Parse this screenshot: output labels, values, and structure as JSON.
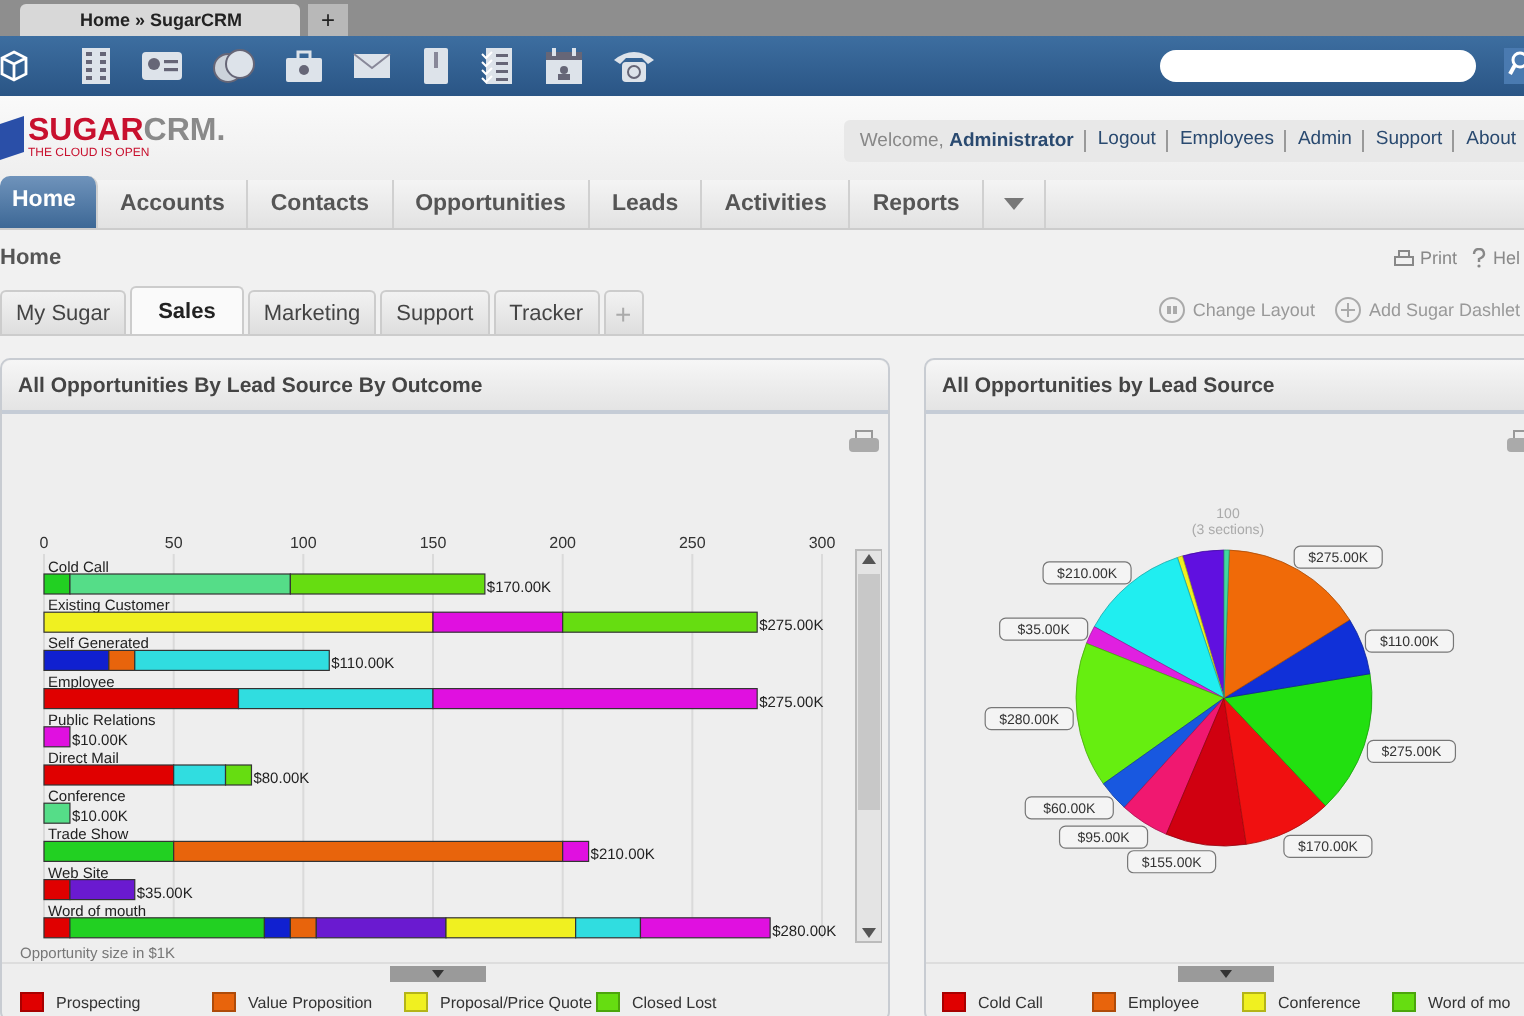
{
  "browser_tab": {
    "title": "Home » SugarCRM",
    "new_tab": "+"
  },
  "logo": {
    "primary": "SUGAR",
    "secondary": "CRM.",
    "tagline": "THE CLOUD IS OPEN"
  },
  "user_links": {
    "welcome": "Welcome, **Administrator**",
    "links": [
      "Logout",
      "Employees",
      "Admin",
      "Support",
      "About"
    ]
  },
  "main_tabs": [
    {
      "label": "Home",
      "selected": true
    },
    {
      "label": "Accounts",
      "selected": false
    },
    {
      "label": "Contacts",
      "selected": false
    },
    {
      "label": "Opportunities",
      "selected": false
    },
    {
      "label": "Leads",
      "selected": false
    },
    {
      "label": "Activities",
      "selected": false
    },
    {
      "label": "Reports",
      "selected": false
    }
  ],
  "page_title": "Home",
  "page_actions": [
    {
      "kind": "print",
      "label": "Print"
    },
    {
      "kind": "help",
      "label": "Hel"
    }
  ],
  "dashboard_tabs": [
    {
      "label": "My Sugar",
      "selected": false
    },
    {
      "label": "Sales",
      "selected": true
    },
    {
      "label": "Marketing",
      "selected": false
    },
    {
      "label": "Support",
      "selected": false
    },
    {
      "label": "Tracker",
      "selected": false
    }
  ],
  "add_tab": "+",
  "dashboard_actions": [
    {
      "kind": "layout",
      "label": "Change Layout"
    },
    {
      "kind": "add",
      "label": "Add Sugar Dashlet"
    }
  ],
  "dashlets": [
    {
      "title": "All Opportunities By Lead Source By Outcome",
      "chart_data": {
        "type": "bar",
        "orientation": "horizontal",
        "stacked": true,
        "grid": true,
        "xlabel": "Opportunity size in $1K",
        "xlim": [
          0,
          300
        ],
        "xticks": [
          0,
          50,
          100,
          150,
          200,
          250,
          300
        ],
        "categories": [
          "Cold Call",
          "Existing Customer",
          "Self Generated",
          "Employee",
          "Public Relations",
          "Direct Mail",
          "Conference",
          "Trade Show",
          "Web Site",
          "Word of mouth"
        ],
        "series": [
          {
            "name": "Prospecting",
            "color": "#e00000",
            "values": [
              null,
              null,
              null,
              75,
              null,
              50,
              null,
              null,
              10,
              10
            ]
          },
          {
            "color": "#22d022",
            "values": [
              10,
              null,
              null,
              null,
              null,
              null,
              null,
              50,
              null,
              75
            ]
          },
          {
            "color": "#55dd88",
            "values": [
              85,
              null,
              null,
              null,
              null,
              null,
              10,
              null,
              null,
              null
            ]
          },
          {
            "color": "#1020d0",
            "values": [
              null,
              null,
              25,
              null,
              null,
              null,
              null,
              null,
              null,
              10
            ]
          },
          {
            "name": "Value Proposition",
            "color": "#e8640c",
            "values": [
              null,
              null,
              10,
              null,
              null,
              null,
              null,
              150,
              null,
              10
            ]
          },
          {
            "color": "#6a1ad0",
            "values": [
              null,
              null,
              null,
              null,
              null,
              null,
              null,
              null,
              25,
              50
            ]
          },
          {
            "name": "Proposal/Price Quote",
            "color": "#f0f020",
            "values": [
              null,
              150,
              null,
              null,
              null,
              null,
              null,
              null,
              null,
              50
            ]
          },
          {
            "color": "#30dde0",
            "values": [
              null,
              null,
              75,
              75,
              null,
              20,
              null,
              null,
              null,
              25
            ]
          },
          {
            "color": "#e010e0",
            "values": [
              null,
              50,
              null,
              125,
              10,
              null,
              null,
              10,
              null,
              50
            ]
          },
          {
            "name": "Closed Lost",
            "color": "#66dd11",
            "values": [
              75,
              75,
              null,
              null,
              null,
              10,
              null,
              null,
              null,
              null
            ]
          }
        ],
        "value_labels": [
          "$170.00K",
          "$275.00K",
          "$110.00K",
          "$275.00K",
          "$10.00K",
          "$80.00K",
          "$10.00K",
          "$210.00K",
          "$35.00K",
          "$280.00K"
        ]
      }
    },
    {
      "title": "All Opportunities by Lead Source",
      "chart_data": {
        "type": "pie",
        "values": [
          80,
          10,
          210,
          35,
          280,
          60,
          95,
          155,
          170,
          275,
          110,
          275,
          10
        ],
        "colors": [
          "#6010e0",
          "#f0f020",
          "#20eef0",
          "#e020e0",
          "#66ee10",
          "#1858e0",
          "#f01870",
          "#d00010",
          "#f01010",
          "#22e010",
          "#1030d8",
          "#f06a08",
          "#40d8a0"
        ],
        "value_labels": [
          null,
          null,
          "$210.00K",
          "$35.00K",
          "$280.00K",
          "$60.00K",
          "$95.00K",
          "$155.00K",
          "$170.00K",
          "$275.00K",
          "$110.00K",
          "$275.00K",
          null
        ],
        "annotations": [
          "100",
          "(3 sections)"
        ]
      },
      "legend": [
        {
          "label": "Cold Call",
          "color": "#e00000"
        },
        {
          "label": "Employee",
          "color": "#e8640c"
        },
        {
          "label": "Conference",
          "color": "#f0f020"
        },
        {
          "label": "Word of mo",
          "color": "#66dd11"
        }
      ]
    }
  ]
}
